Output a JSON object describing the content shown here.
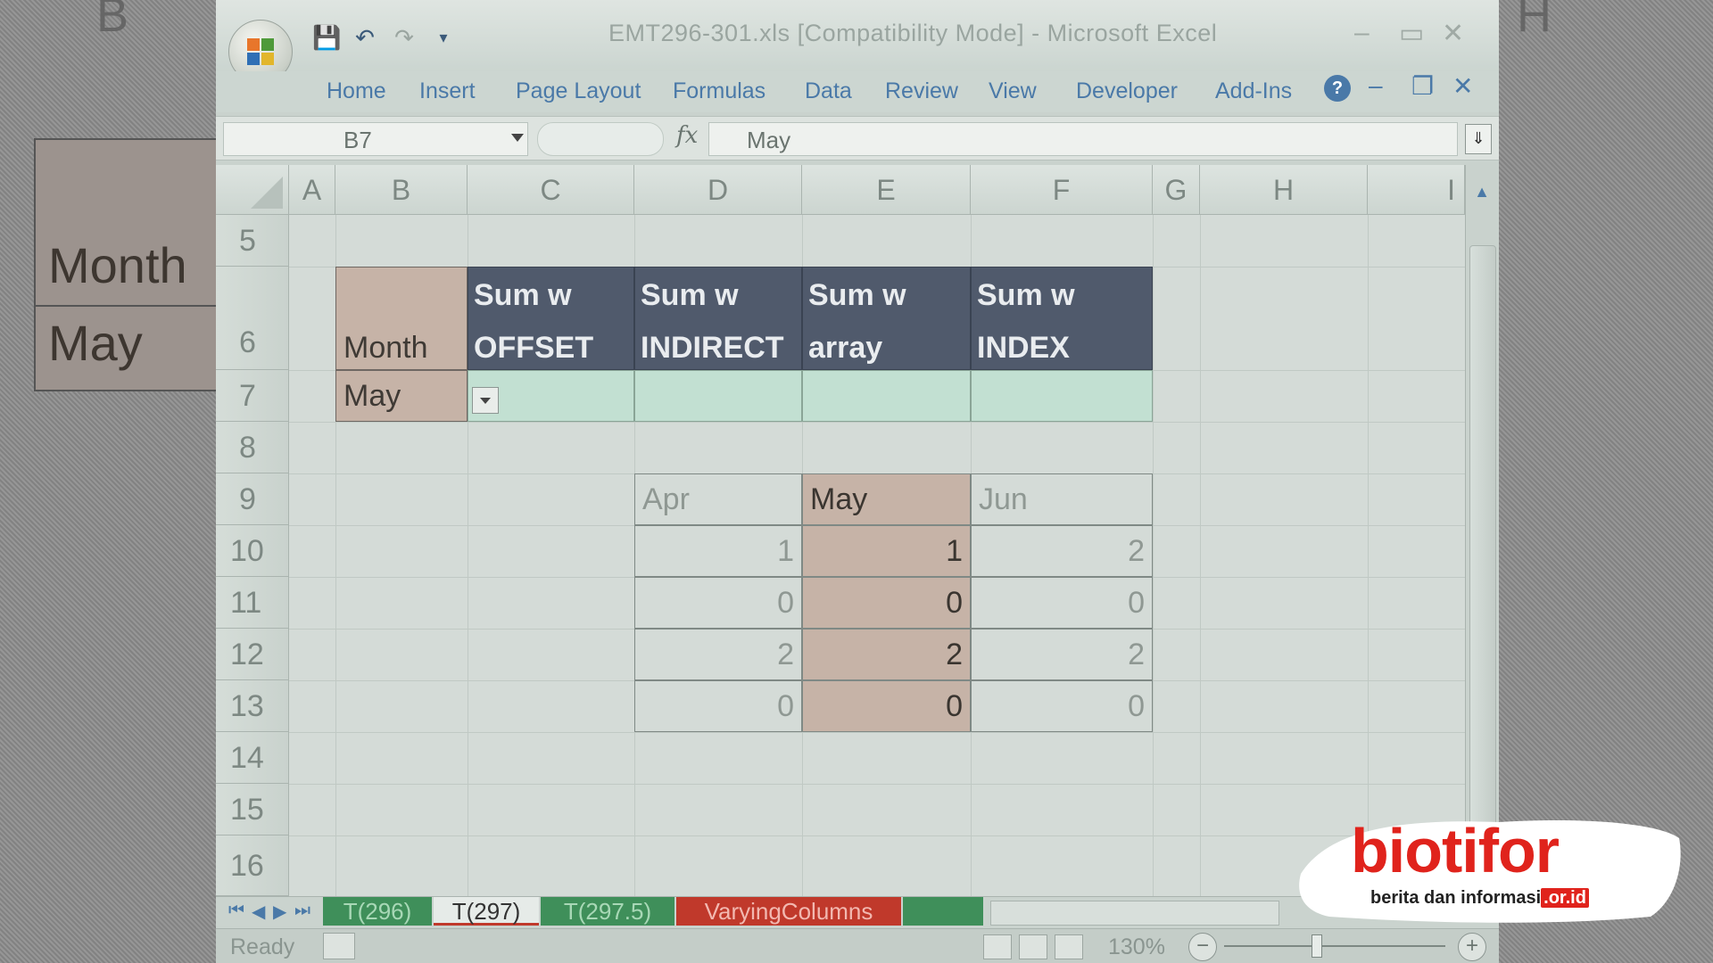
{
  "background": {
    "col_letters": [
      "B",
      "H"
    ],
    "zoom_labels": [
      "Month",
      "May"
    ]
  },
  "window": {
    "title": "EMT296-301.xls [Compatibility Mode] - Microsoft Excel",
    "ribbon_tabs": [
      "Home",
      "Insert",
      "Page Layout",
      "Formulas",
      "Data",
      "Review",
      "View",
      "Developer",
      "Add-Ins"
    ]
  },
  "formula_bar": {
    "name_box": "B7",
    "fx": "fx",
    "formula": "May"
  },
  "columns": [
    "A",
    "B",
    "C",
    "D",
    "E",
    "F",
    "G",
    "H",
    "I"
  ],
  "rows": [
    "5",
    "6",
    "7",
    "8",
    "9",
    "10",
    "11",
    "12",
    "13",
    "14",
    "15",
    "16"
  ],
  "header_table": {
    "month_label": "Month",
    "headers": [
      [
        "Sum w",
        "OFFSET"
      ],
      [
        "Sum w",
        "INDIRECT"
      ],
      [
        "Sum w",
        "array"
      ],
      [
        "Sum w",
        "INDEX"
      ]
    ],
    "selected_month": "May"
  },
  "data_table": {
    "months": [
      "Apr",
      "May",
      "Jun"
    ],
    "rows": [
      [
        "1",
        "1",
        "2"
      ],
      [
        "0",
        "0",
        "0"
      ],
      [
        "2",
        "2",
        "2"
      ],
      [
        "0",
        "0",
        "0"
      ]
    ]
  },
  "sheet_tabs": [
    "T(296)",
    "T(297)",
    "T(297.5)",
    "VaryingColumns"
  ],
  "active_sheet": "T(297)",
  "status": {
    "ready": "Ready",
    "zoom": "130%"
  },
  "watermark": {
    "brand": "biotifor",
    "tagline": "berita dan informasi",
    "domain": ".or.id"
  },
  "colors": {
    "header_dark": "#505a6c",
    "month_tan": "#c6b3a7",
    "green_input": "#c2e0d2",
    "watermark_red": "#e0231c"
  }
}
